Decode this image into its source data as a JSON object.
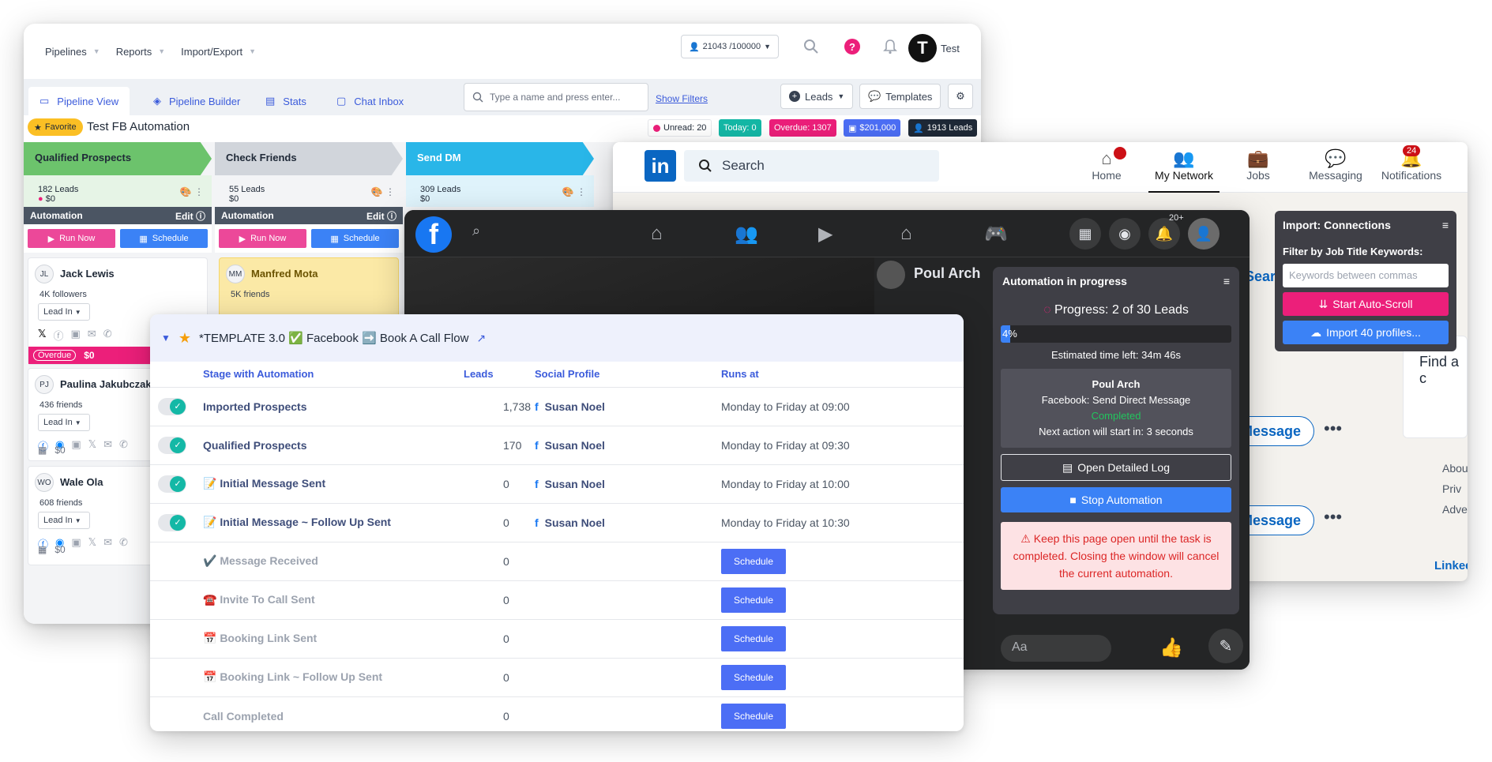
{
  "crm": {
    "nav": [
      "Pipelines",
      "Reports",
      "Import/Export"
    ],
    "credits": "21043 /100000",
    "help": "?",
    "avatar_letter": "T",
    "user": "Test",
    "tabs": [
      "Pipeline View",
      "Pipeline Builder",
      "Stats",
      "Chat Inbox"
    ],
    "search_placeholder": "Type a name and press enter...",
    "show_filters": "Show Filters",
    "leads_btn": "Leads",
    "templates_btn": "Templates",
    "favorite": "Favorite",
    "pipeline_title": "Test FB Automation",
    "stats": {
      "unread": "Unread: 20",
      "today": "Today: 0",
      "overdue": "Overdue: 1307",
      "money": "$201,000",
      "leads": "1913 Leads"
    },
    "columns": [
      {
        "title": "Qualified Prospects",
        "leads": "182 Leads",
        "amount": "$0",
        "color": "#6cc36c"
      },
      {
        "title": "Check Friends",
        "leads": "55 Leads",
        "amount": "$0",
        "color": "#d1d5db"
      },
      {
        "title": "Send DM",
        "leads": "309 Leads",
        "amount": "$0",
        "color": "#29b6e8"
      }
    ],
    "automation_label": "Automation",
    "edit_label": "Edit",
    "run_now": "Run Now",
    "schedule": "Schedule",
    "cards": [
      {
        "initials": "JL",
        "name": "Jack Lewis",
        "followers": "4K followers",
        "stage": "Lead In",
        "overdue": "Overdue",
        "amount": "$0"
      },
      {
        "initials": "PJ",
        "name": "Paulina Jakubczak",
        "followers": "436 friends",
        "stage": "Lead In",
        "amount": "$0"
      },
      {
        "initials": "WO",
        "name": "Wale Ola",
        "followers": "608 friends",
        "stage": "Lead In",
        "amount": "$0"
      },
      {
        "initials": "MM",
        "name": "Manfred Mota",
        "followers": "5K friends"
      }
    ]
  },
  "linkedin": {
    "logo": "in",
    "search": "Search",
    "nav": [
      "Home",
      "My Network",
      "Jobs",
      "Messaging",
      "Notifications"
    ],
    "notif_count": "24",
    "message_btn": "Message",
    "find_text": "Find a c",
    "sidebar_links": [
      "Abou",
      "Priv",
      "Adve"
    ],
    "brand_text": "Linked",
    "search_partial": "Sear"
  },
  "import_panel": {
    "title": "Import: Connections",
    "filter_label": "Filter by Job Title Keywords:",
    "placeholder": "Keywords between commas",
    "start_btn": "Start Auto-Scroll",
    "import_btn": "Import 40 profiles..."
  },
  "facebook": {
    "profile_name": "Poul Arch",
    "notif_count": "20+",
    "message_placeholder": "Aa"
  },
  "automation": {
    "title": "Automation in progress",
    "progress": "Progress: 2 of 30 Leads",
    "progress_pct": "4%",
    "progress_fraction": 0.04,
    "eta": "Estimated time left: 34m 46s",
    "lead_name": "Poul Arch",
    "action": "Facebook: Send Direct Message",
    "status": "Completed",
    "next": "Next action will start in: 3 seconds",
    "log_btn": "Open Detailed Log",
    "stop_btn": "Stop Automation",
    "warning": "Keep this page open until the task is completed. Closing the window will cancel the current automation."
  },
  "template": {
    "title": "*TEMPLATE 3.0 ✅ Facebook ➡️ Book A Call Flow",
    "headers": [
      "Stage with Automation",
      "Leads",
      "Social Profile",
      "Runs at"
    ],
    "rows": [
      {
        "stage": "Imported Prospects",
        "leads": "1,738",
        "profile": "Susan Noel",
        "runs": "Monday to Friday at 09:00",
        "on": true
      },
      {
        "stage": "Qualified Prospects",
        "leads": "170",
        "profile": "Susan Noel",
        "runs": "Monday to Friday at 09:30",
        "on": true
      },
      {
        "stage": "📝 Initial Message Sent",
        "leads": "0",
        "profile": "Susan Noel",
        "runs": "Monday to Friday at 10:00",
        "on": true
      },
      {
        "stage": "📝 Initial Message ~ Follow Up Sent",
        "leads": "0",
        "profile": "Susan Noel",
        "runs": "Monday to Friday at 10:30",
        "on": true
      },
      {
        "stage": "✔️ Message Received",
        "leads": "0",
        "runs": "Schedule",
        "on": false
      },
      {
        "stage": "☎️ Invite To Call Sent",
        "leads": "0",
        "runs": "Schedule",
        "on": false
      },
      {
        "stage": "📅 Booking Link Sent",
        "leads": "0",
        "runs": "Schedule",
        "on": false
      },
      {
        "stage": "📅 Booking Link ~ Follow Up Sent",
        "leads": "0",
        "runs": "Schedule",
        "on": false
      },
      {
        "stage": "Call Completed",
        "leads": "0",
        "runs": "Schedule",
        "on": false
      }
    ]
  }
}
